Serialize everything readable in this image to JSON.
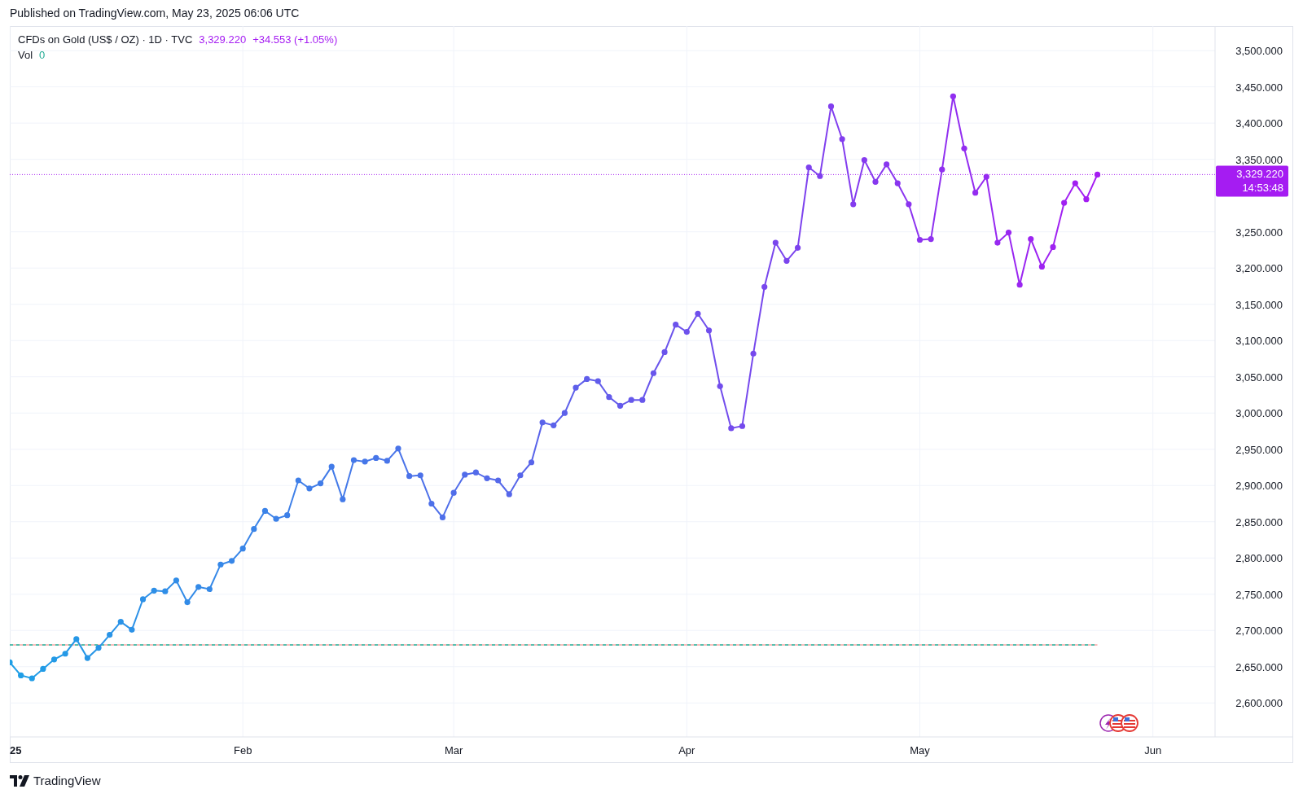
{
  "header": {
    "published": "Published on TradingView.com, May 23, 2025 06:06 UTC"
  },
  "legend": {
    "interval": "· 1D · TVC",
    "price": "3,329.220",
    "change": "+34.553 (+1.05%)",
    "volume_label": "Vol",
    "volume_value": "0"
  },
  "chart_data": {
    "type": "line",
    "categories": [
      "25",
      null,
      null,
      null,
      null,
      null,
      null,
      null,
      null,
      null,
      null,
      null,
      null,
      null,
      null,
      null,
      null,
      null,
      null,
      null,
      null,
      "Feb",
      null,
      null,
      null,
      null,
      null,
      null,
      null,
      null,
      null,
      null,
      null,
      null,
      null,
      null,
      null,
      null,
      null,
      null,
      "Mar",
      null,
      null,
      null,
      null,
      null,
      null,
      null,
      null,
      null,
      null,
      null,
      null,
      null,
      null,
      null,
      null,
      null,
      null,
      null,
      null,
      "Apr",
      null,
      null,
      null,
      null,
      null,
      null,
      null,
      null,
      null,
      null,
      null,
      null,
      null,
      null,
      null,
      null,
      null,
      null,
      null,
      null,
      "May",
      null,
      null,
      null,
      null,
      null,
      null,
      null,
      null,
      null,
      null,
      null,
      null,
      null,
      null,
      null,
      null,
      null,
      null,
      null,
      null,
      "Jun",
      null,
      null,
      null,
      null,
      null
    ],
    "grid": true,
    "series": [
      {
        "name": "CFDs on Gold (US$ / OZ)",
        "marker": "o",
        "values": [
          2656,
          2638,
          2634,
          2647,
          2660,
          2668,
          2688,
          2662,
          2676,
          2694,
          2712,
          2701,
          2743,
          2755,
          2754,
          2769,
          2739,
          2760,
          2757,
          2791,
          2796,
          2813,
          2840,
          2865,
          2854,
          2859,
          2907,
          2896,
          2903,
          2926,
          2881,
          2935,
          2933,
          2938,
          2934,
          2951,
          2913,
          2914,
          2875,
          2856,
          2890,
          2915,
          2918,
          2910,
          2907,
          2888,
          2914,
          2932,
          2987,
          2983,
          3000,
          3035,
          3047,
          3044,
          3022,
          3010,
          3018,
          3018,
          3055,
          3084,
          3122,
          3112,
          3137,
          3114,
          3037,
          2979,
          2982,
          3082,
          3174,
          3235,
          3210,
          3228,
          3339,
          3327,
          3423,
          3378,
          3288,
          3349,
          3319,
          3343,
          3317,
          3288,
          3239,
          3240,
          3336,
          3437,
          3365,
          3304,
          3326,
          3235,
          3249,
          3177,
          3240,
          3202,
          3229,
          3290,
          3317,
          3295,
          3329,
          null,
          null,
          null,
          null,
          null,
          null,
          null,
          null,
          null,
          null
        ]
      }
    ],
    "ylim": [
      2553.1,
      3533.9
    ],
    "yticks": [
      {
        "value": 2600,
        "label": "2,600.000"
      },
      {
        "value": 2650,
        "label": "2,650.000"
      },
      {
        "value": 2700,
        "label": "2,700.000"
      },
      {
        "value": 2750,
        "label": "2,750.000"
      },
      {
        "value": 2800,
        "label": "2,800.000"
      },
      {
        "value": 2850,
        "label": "2,850.000"
      },
      {
        "value": 2900,
        "label": "2,900.000"
      },
      {
        "value": 2950,
        "label": "2,950.000"
      },
      {
        "value": 3000,
        "label": "3,000.000"
      },
      {
        "value": 3050,
        "label": "3,050.000"
      },
      {
        "value": 3100,
        "label": "3,100.000"
      },
      {
        "value": 3150,
        "label": "3,150.000"
      },
      {
        "value": 3200,
        "label": "3,200.000"
      },
      {
        "value": 3250,
        "label": "3,250.000"
      },
      {
        "value": 3350,
        "label": "3,350.000"
      },
      {
        "value": 3400,
        "label": "3,400.000"
      },
      {
        "value": 3450,
        "label": "3,450.000"
      },
      {
        "value": 3500,
        "label": "3,500.000"
      }
    ],
    "ref_lines": [
      {
        "axis": "y",
        "value": 3329,
        "color": "#a51cf2"
      },
      {
        "axis": "y",
        "value": 2680,
        "color": "#22ab94"
      },
      {
        "axis": "y",
        "value": 2680,
        "color": "#f7a9a7"
      }
    ]
  },
  "price_tag": {
    "price": "3,329.220",
    "countdown": "14:53:48"
  },
  "footer": {
    "brand": "TradingView"
  }
}
